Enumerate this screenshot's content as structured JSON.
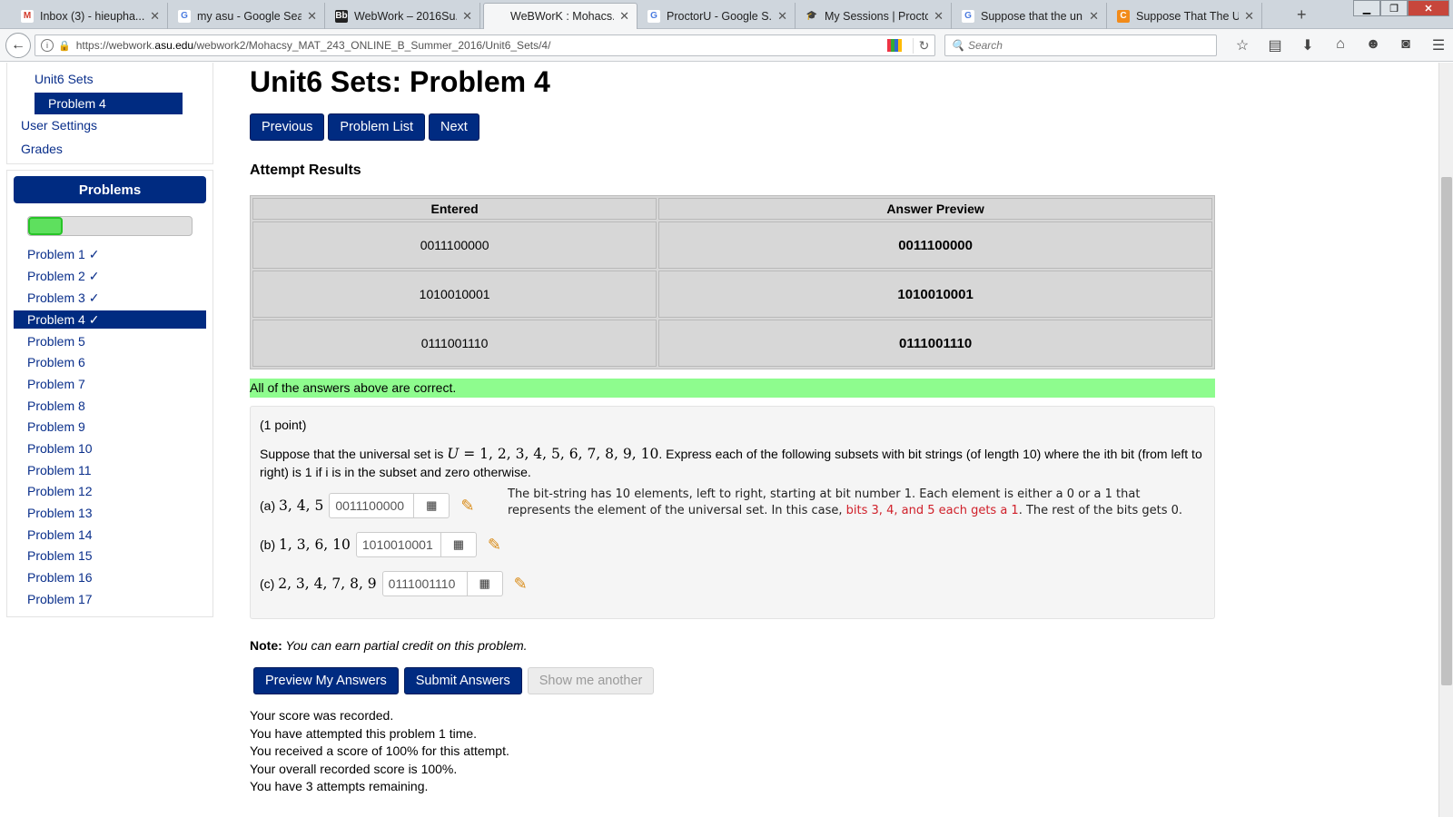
{
  "browser": {
    "tabs": [
      {
        "label": "Inbox (3) - hieupha...",
        "fav": "M",
        "favColor": "#d23b2b",
        "favBg": "#fff"
      },
      {
        "label": "my asu - Google Sea...",
        "fav": "G",
        "favColor": "#4a7be0",
        "favBg": "#fff"
      },
      {
        "label": "WebWork – 2016Su...",
        "fav": "Bb",
        "favColor": "#fff",
        "favBg": "#222"
      },
      {
        "label": "WeBWorK : Mohacs...",
        "fav": "",
        "favColor": "#000",
        "favBg": "transparent"
      },
      {
        "label": "ProctorU - Google S...",
        "fav": "G",
        "favColor": "#4a7be0",
        "favBg": "#fff"
      },
      {
        "label": "My Sessions | Procto...",
        "fav": "🎓",
        "favColor": "#2a6fd0",
        "favBg": "transparent"
      },
      {
        "label": "Suppose that the un...",
        "fav": "G",
        "favColor": "#4a7be0",
        "favBg": "#fff"
      },
      {
        "label": "Suppose That The U...",
        "fav": "C",
        "favColor": "#fff",
        "favBg": "#f28b1a"
      }
    ],
    "close_glyph": "✕",
    "newtab_glyph": "+",
    "url_pre": "https://webwork.",
    "url_host": "asu.edu",
    "url_post": "/webwork2/Mohacsy_MAT_243_ONLINE_B_Summer_2016/Unit6_Sets/4/",
    "search_placeholder": "Search"
  },
  "sidebar": {
    "unit_link": "Unit6 Sets",
    "selected": "Problem 4",
    "user_settings": "User Settings",
    "grades": "Grades",
    "problems_header": "Problems",
    "progress_fraction": 0.21,
    "problems": [
      "Problem 1 ✓",
      "Problem 2 ✓",
      "Problem 3 ✓",
      "Problem 4 ✓",
      "Problem 5",
      "Problem 6",
      "Problem 7",
      "Problem 8",
      "Problem 9",
      "Problem 10",
      "Problem 11",
      "Problem 12",
      "Problem 13",
      "Problem 14",
      "Problem 15",
      "Problem 16",
      "Problem 17"
    ],
    "active_index": 3
  },
  "main": {
    "title": "Unit6 Sets: Problem 4",
    "nav": {
      "previous": "Previous",
      "problem_list": "Problem List",
      "next": "Next"
    },
    "attempt_results": "Attempt Results",
    "table": {
      "headers": [
        "Entered",
        "Answer Preview"
      ],
      "rows": [
        [
          "0011100000",
          "0011100000"
        ],
        [
          "1010010001",
          "1010010001"
        ],
        [
          "0111001110",
          "0111001110"
        ]
      ]
    },
    "correct_msg": "All of the answers above are correct.",
    "points": "(1 point)",
    "statement_a": "Suppose that the universal set is",
    "statement_math_var": "U",
    "statement_math_rest": " = 1, 2, 3, 4, 5, 6, 7, 8, 9, 10",
    "statement_b": ". Express each of the following subsets with bit strings (of length 10) where the ith bit (from left to right) is 1 if i is in the subset and zero otherwise.",
    "answers": [
      {
        "label": "(a)",
        "set": "3, 4, 5",
        "value": "0011100000"
      },
      {
        "label": "(b)",
        "set": "1, 3, 6, 10",
        "value": "1010010001"
      },
      {
        "label": "(c)",
        "set": "2, 3, 4, 7, 8, 9",
        "value": "0111001110"
      }
    ],
    "hint_a": "The bit-string has 10 elements, left to right, starting at bit number 1. Each element is either a 0 or a 1 that represents the element of the universal set. In this case, ",
    "hint_red": "bits 3, 4, and 5 each gets a 1",
    "hint_b": ". The rest of the bits gets 0.",
    "note_label": "Note:",
    "note_text": " You can earn partial credit on this problem.",
    "buttons": {
      "preview": "Preview My Answers",
      "submit": "Submit Answers",
      "another": "Show me another"
    },
    "score_lines": [
      "Your score was recorded.",
      "You have attempted this problem 1 time.",
      "You received a score of 100% for this attempt.",
      "Your overall recorded score is 100%.",
      "You have 3 attempts remaining."
    ]
  }
}
